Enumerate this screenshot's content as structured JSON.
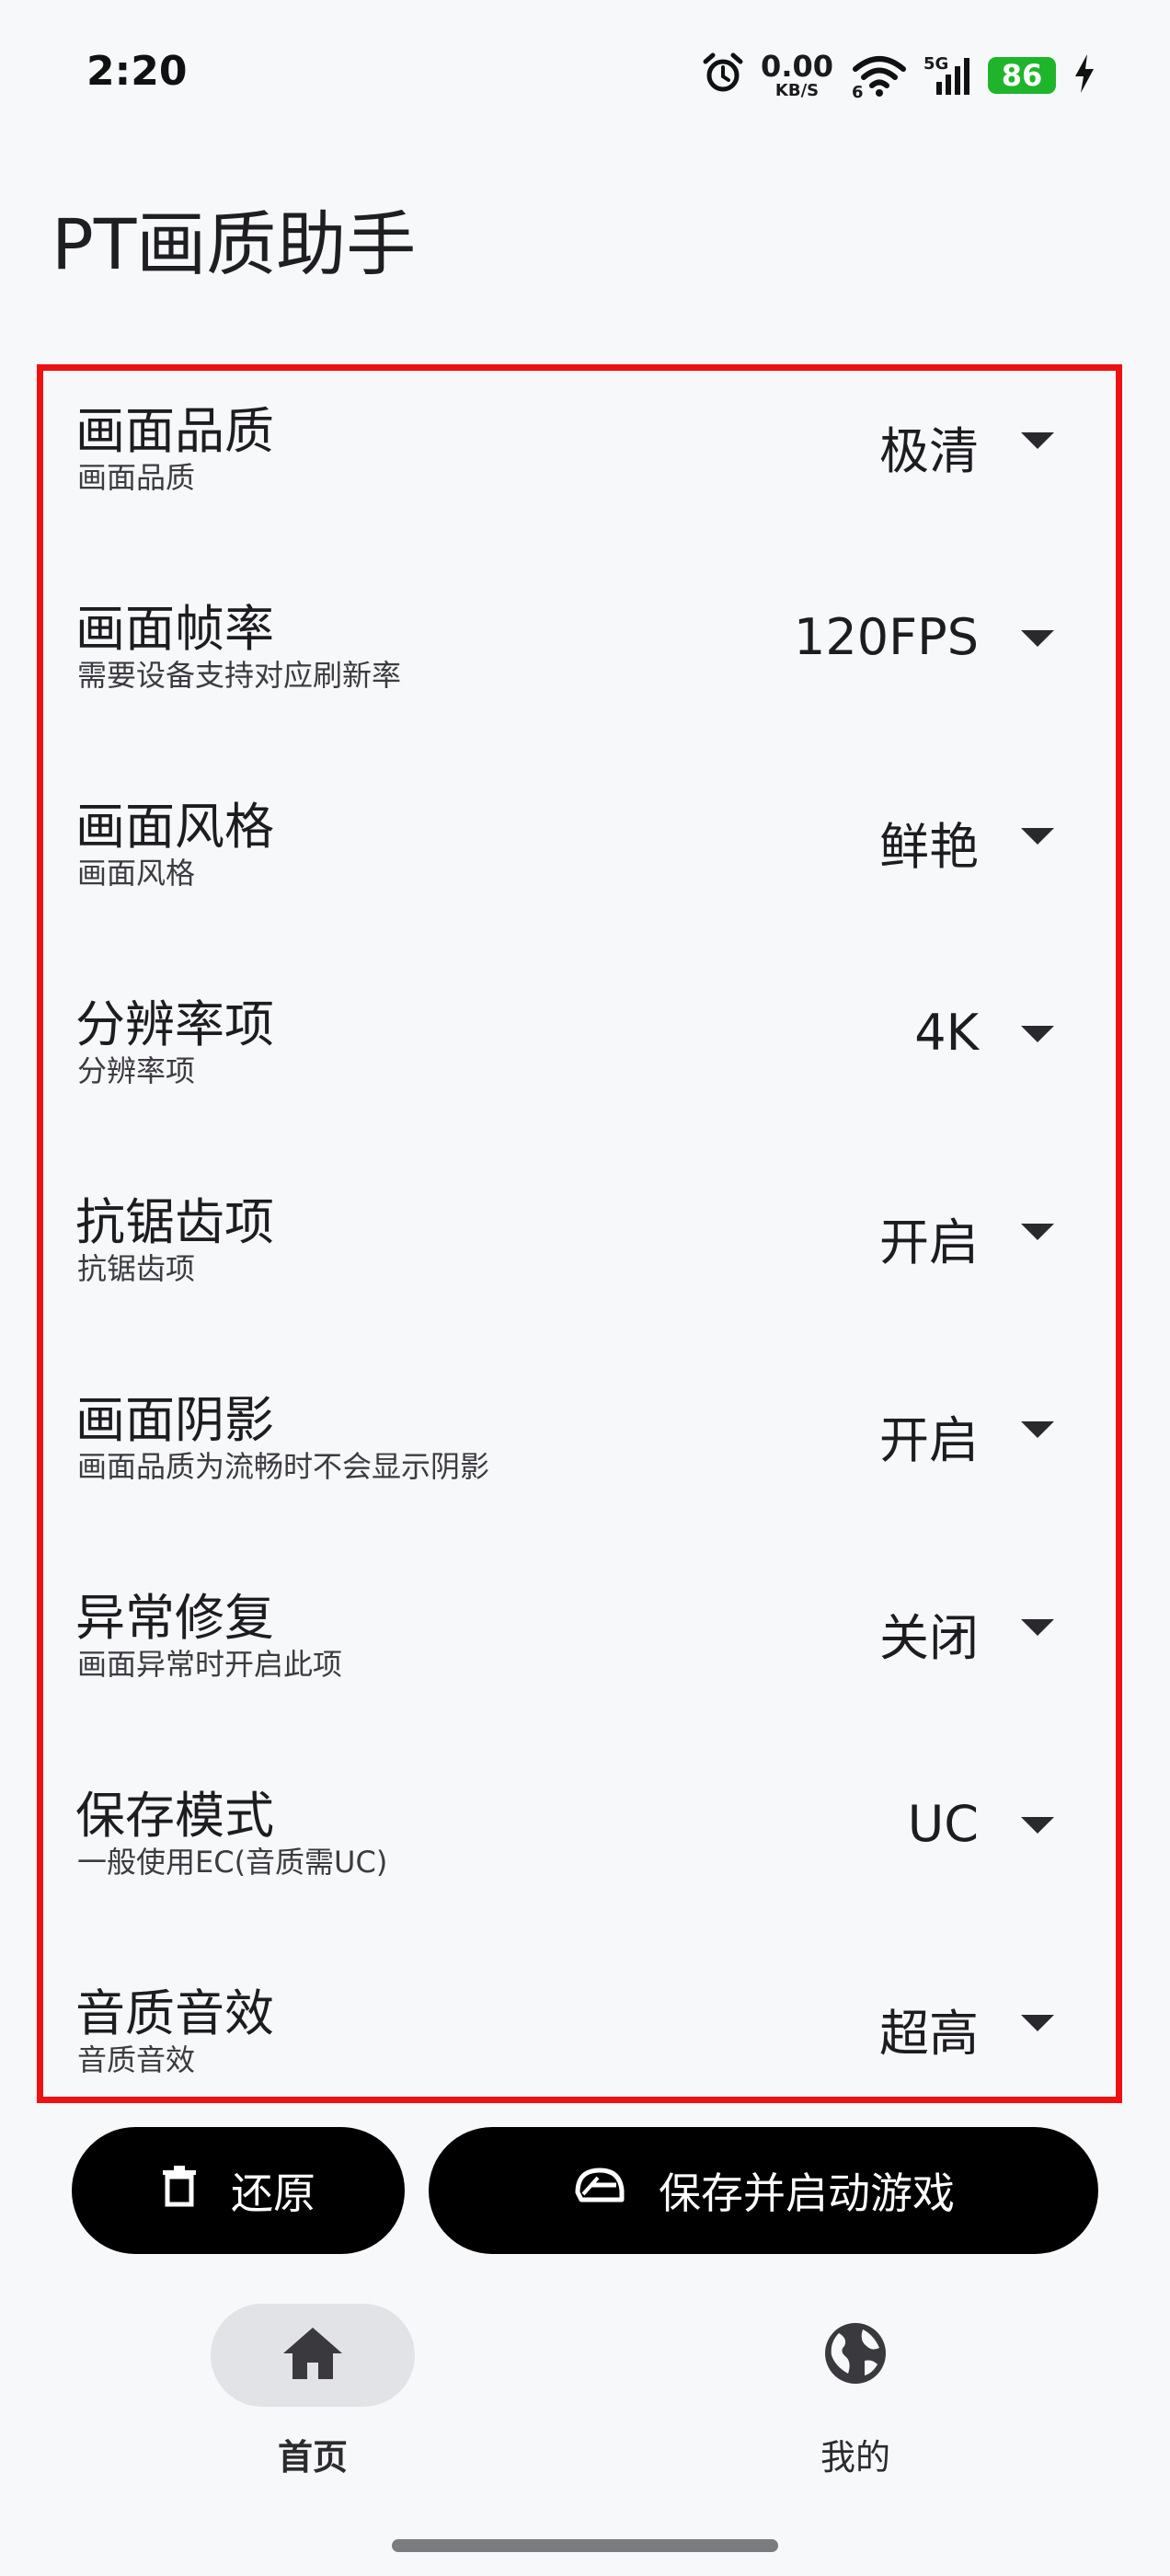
{
  "status_bar": {
    "time": "2:20",
    "net_speed_value": "0.00",
    "net_speed_unit": "KB/S",
    "wifi_badge": "6",
    "signal_badge": "5G",
    "battery_level": "86"
  },
  "page_title": "PT画质助手",
  "settings": [
    {
      "title": "画面品质",
      "subtitle": "画面品质",
      "value": "极清"
    },
    {
      "title": "画面帧率",
      "subtitle": "需要设备支持对应刷新率",
      "value": "120FPS"
    },
    {
      "title": "画面风格",
      "subtitle": "画面风格",
      "value": "鲜艳"
    },
    {
      "title": "分辨率项",
      "subtitle": "分辨率项",
      "value": "4K"
    },
    {
      "title": "抗锯齿项",
      "subtitle": "抗锯齿项",
      "value": "开启"
    },
    {
      "title": "画面阴影",
      "subtitle": "画面品质为流畅时不会显示阴影",
      "value": "开启"
    },
    {
      "title": "异常修复",
      "subtitle": "画面异常时开启此项",
      "value": "关闭"
    },
    {
      "title": "保存模式",
      "subtitle": "一般使用EC(音质需UC)",
      "value": "UC"
    },
    {
      "title": "音质音效",
      "subtitle": "音质音效",
      "value": "超高"
    }
  ],
  "actions": {
    "restore_label": "还原",
    "save_label": "保存并启动游戏"
  },
  "bottom_nav": [
    {
      "label": "首页",
      "icon": "home-icon",
      "active": true
    },
    {
      "label": "我的",
      "icon": "globe-icon",
      "active": false
    }
  ],
  "colors": {
    "background": "#f7f8fa",
    "highlight_border": "#ee1111",
    "button_bg": "#000000",
    "battery": "#1fb52b"
  }
}
